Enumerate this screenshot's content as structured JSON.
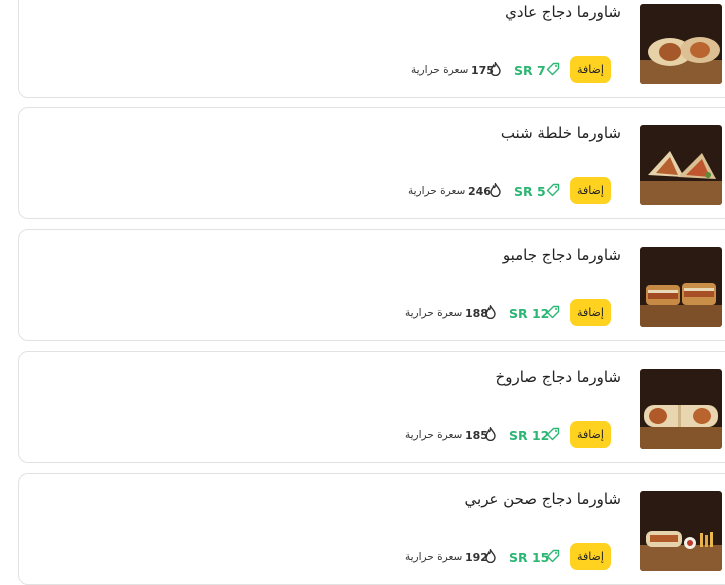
{
  "items": [
    {
      "name": "شاورما دجاج عادي",
      "add_label": "إضافة",
      "price": "SR 7",
      "calories": "175",
      "calories_label": "سعرة حرارية",
      "image_icon": "shawarma-wrap-photo",
      "photo_style": "wrap"
    },
    {
      "name": "شاورما خلطة شنب",
      "add_label": "إضافة",
      "price": "SR 5",
      "calories": "246",
      "calories_label": "سعرة حرارية",
      "image_icon": "shawarma-wrap-photo",
      "photo_style": "pita"
    },
    {
      "name": "شاورما دجاج جامبو",
      "add_label": "إضافة",
      "price": "SR 12",
      "calories": "188",
      "calories_label": "سعرة حرارية",
      "image_icon": "shawarma-sandwich-photo",
      "photo_style": "sandwich"
    },
    {
      "name": "شاورما دجاج صاروخ",
      "add_label": "إضافة",
      "price": "SR 12",
      "calories": "185",
      "calories_label": "سعرة حرارية",
      "image_icon": "shawarma-wrap-photo",
      "photo_style": "wrap"
    },
    {
      "name": "شاورما دجاج صحن عربي",
      "add_label": "إضافة",
      "price": "SR 15",
      "calories": "192",
      "calories_label": "سعرة حرارية",
      "image_icon": "shawarma-plate-photo",
      "photo_style": "plate"
    }
  ],
  "colors": {
    "accent": "#ffd21f",
    "price": "#2bb673",
    "border": "#e2e2e2",
    "photo_bg": "#2b1a12",
    "board": "#8a5a30"
  }
}
